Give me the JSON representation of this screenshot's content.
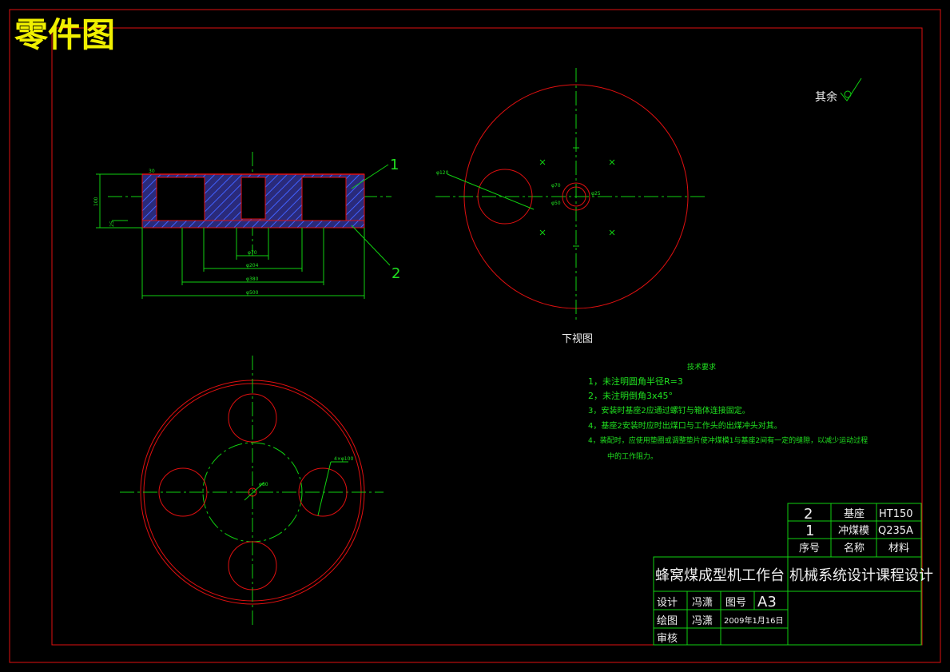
{
  "sheet": {
    "title": "零件图",
    "colors": {
      "border": "#e01010",
      "lines": "#10d010",
      "title": "#f0f000",
      "background": "#000000"
    }
  },
  "surface_finish": "其余",
  "section_view": {
    "balloons": [
      "1",
      "2"
    ],
    "dims": [
      "φ70",
      "φ204",
      "φ380",
      "φ500",
      "100",
      "25",
      "30"
    ]
  },
  "bottom_view": {
    "label": "下视图",
    "dims": [
      "φ120",
      "φ70",
      "φ50",
      "φ25",
      "φ70"
    ]
  },
  "top_view": {
    "dims": [
      "4×φ100",
      "φ80"
    ]
  },
  "tech_requirements": {
    "title": "技术要求",
    "items": [
      "1，未注明圆角半径R=3",
      "2，未注明倒角3x45°",
      "3，安装时基座2应通过螺钉与箱体连接固定。",
      "4，基座2安装时应时出煤口与工作头的出煤冲头对其。",
      "4，装配时，应使用垫圈或调整垫片使冲煤模1与基座2间有一定的缝隙，以减少运动过程",
      "中的工作阻力。"
    ]
  },
  "parts_list": {
    "rows": [
      {
        "no": "2",
        "name": "基座",
        "material": "HT150"
      },
      {
        "no": "1",
        "name": "冲煤模",
        "material": "Q235A"
      }
    ],
    "header": {
      "no": "序号",
      "name": "名称",
      "material": "材料"
    }
  },
  "title_block": {
    "product": "蜂窝煤成型机工作台",
    "course": "机械系统设计课程设计",
    "design_label": "设计",
    "design_name": "冯潇",
    "drawing_no_label": "图号",
    "drawing_no": "A3",
    "draw_label": "绘图",
    "draw_name": "冯潇",
    "date": "2009年1月16日",
    "review_label": "审核"
  }
}
